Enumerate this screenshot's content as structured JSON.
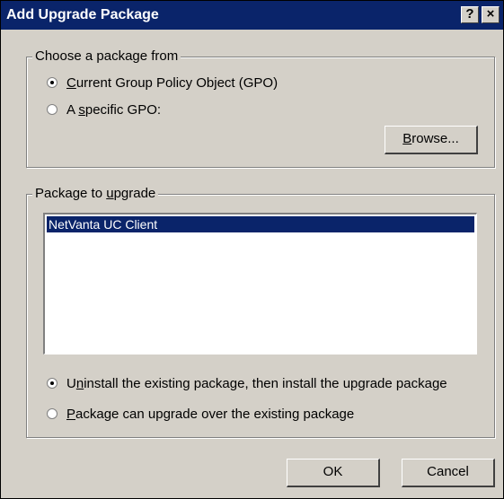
{
  "window": {
    "title": "Add Upgrade Package",
    "help_label": "?",
    "close_label": "×"
  },
  "source_group": {
    "label": "Choose a package from",
    "option_current": {
      "prefix": "",
      "accel": "C",
      "rest": "urrent Group Policy Object (GPO)",
      "checked": true
    },
    "option_specific": {
      "prefix": "A ",
      "accel": "s",
      "rest": "pecific GPO:",
      "checked": false
    },
    "browse": {
      "prefix": "",
      "accel": "B",
      "rest": "rowse..."
    }
  },
  "package_group": {
    "label_prefix": "Package to ",
    "label_accel": "u",
    "label_rest": "pgrade",
    "items": [
      {
        "label": "NetVanta UC Client",
        "selected": true
      }
    ],
    "option_uninstall": {
      "prefix": "U",
      "accel": "n",
      "rest": "install the existing package, then install the upgrade package",
      "checked": true
    },
    "option_over": {
      "prefix": "",
      "accel": "P",
      "rest": "ackage can upgrade over the existing package",
      "checked": false
    }
  },
  "buttons": {
    "ok": "OK",
    "cancel": "Cancel"
  },
  "colors": {
    "titlebar": "#0a246a",
    "face": "#d4d0c8",
    "selection": "#0a246a"
  }
}
